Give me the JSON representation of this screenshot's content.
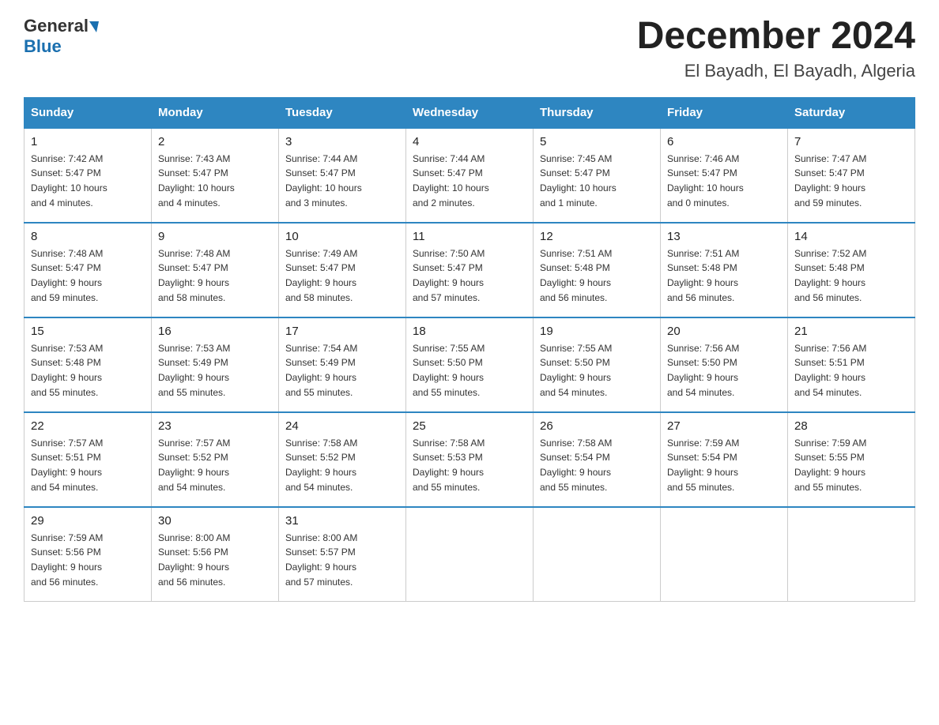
{
  "header": {
    "logo_general": "General",
    "logo_blue": "Blue",
    "month_title": "December 2024",
    "location": "El Bayadh, El Bayadh, Algeria"
  },
  "calendar": {
    "days_of_week": [
      "Sunday",
      "Monday",
      "Tuesday",
      "Wednesday",
      "Thursday",
      "Friday",
      "Saturday"
    ],
    "weeks": [
      [
        {
          "day": "1",
          "sunrise": "7:42 AM",
          "sunset": "5:47 PM",
          "daylight": "10 hours and 4 minutes."
        },
        {
          "day": "2",
          "sunrise": "7:43 AM",
          "sunset": "5:47 PM",
          "daylight": "10 hours and 4 minutes."
        },
        {
          "day": "3",
          "sunrise": "7:44 AM",
          "sunset": "5:47 PM",
          "daylight": "10 hours and 3 minutes."
        },
        {
          "day": "4",
          "sunrise": "7:44 AM",
          "sunset": "5:47 PM",
          "daylight": "10 hours and 2 minutes."
        },
        {
          "day": "5",
          "sunrise": "7:45 AM",
          "sunset": "5:47 PM",
          "daylight": "10 hours and 1 minute."
        },
        {
          "day": "6",
          "sunrise": "7:46 AM",
          "sunset": "5:47 PM",
          "daylight": "10 hours and 0 minutes."
        },
        {
          "day": "7",
          "sunrise": "7:47 AM",
          "sunset": "5:47 PM",
          "daylight": "9 hours and 59 minutes."
        }
      ],
      [
        {
          "day": "8",
          "sunrise": "7:48 AM",
          "sunset": "5:47 PM",
          "daylight": "9 hours and 59 minutes."
        },
        {
          "day": "9",
          "sunrise": "7:48 AM",
          "sunset": "5:47 PM",
          "daylight": "9 hours and 58 minutes."
        },
        {
          "day": "10",
          "sunrise": "7:49 AM",
          "sunset": "5:47 PM",
          "daylight": "9 hours and 58 minutes."
        },
        {
          "day": "11",
          "sunrise": "7:50 AM",
          "sunset": "5:47 PM",
          "daylight": "9 hours and 57 minutes."
        },
        {
          "day": "12",
          "sunrise": "7:51 AM",
          "sunset": "5:48 PM",
          "daylight": "9 hours and 56 minutes."
        },
        {
          "day": "13",
          "sunrise": "7:51 AM",
          "sunset": "5:48 PM",
          "daylight": "9 hours and 56 minutes."
        },
        {
          "day": "14",
          "sunrise": "7:52 AM",
          "sunset": "5:48 PM",
          "daylight": "9 hours and 56 minutes."
        }
      ],
      [
        {
          "day": "15",
          "sunrise": "7:53 AM",
          "sunset": "5:48 PM",
          "daylight": "9 hours and 55 minutes."
        },
        {
          "day": "16",
          "sunrise": "7:53 AM",
          "sunset": "5:49 PM",
          "daylight": "9 hours and 55 minutes."
        },
        {
          "day": "17",
          "sunrise": "7:54 AM",
          "sunset": "5:49 PM",
          "daylight": "9 hours and 55 minutes."
        },
        {
          "day": "18",
          "sunrise": "7:55 AM",
          "sunset": "5:50 PM",
          "daylight": "9 hours and 55 minutes."
        },
        {
          "day": "19",
          "sunrise": "7:55 AM",
          "sunset": "5:50 PM",
          "daylight": "9 hours and 54 minutes."
        },
        {
          "day": "20",
          "sunrise": "7:56 AM",
          "sunset": "5:50 PM",
          "daylight": "9 hours and 54 minutes."
        },
        {
          "day": "21",
          "sunrise": "7:56 AM",
          "sunset": "5:51 PM",
          "daylight": "9 hours and 54 minutes."
        }
      ],
      [
        {
          "day": "22",
          "sunrise": "7:57 AM",
          "sunset": "5:51 PM",
          "daylight": "9 hours and 54 minutes."
        },
        {
          "day": "23",
          "sunrise": "7:57 AM",
          "sunset": "5:52 PM",
          "daylight": "9 hours and 54 minutes."
        },
        {
          "day": "24",
          "sunrise": "7:58 AM",
          "sunset": "5:52 PM",
          "daylight": "9 hours and 54 minutes."
        },
        {
          "day": "25",
          "sunrise": "7:58 AM",
          "sunset": "5:53 PM",
          "daylight": "9 hours and 55 minutes."
        },
        {
          "day": "26",
          "sunrise": "7:58 AM",
          "sunset": "5:54 PM",
          "daylight": "9 hours and 55 minutes."
        },
        {
          "day": "27",
          "sunrise": "7:59 AM",
          "sunset": "5:54 PM",
          "daylight": "9 hours and 55 minutes."
        },
        {
          "day": "28",
          "sunrise": "7:59 AM",
          "sunset": "5:55 PM",
          "daylight": "9 hours and 55 minutes."
        }
      ],
      [
        {
          "day": "29",
          "sunrise": "7:59 AM",
          "sunset": "5:56 PM",
          "daylight": "9 hours and 56 minutes."
        },
        {
          "day": "30",
          "sunrise": "8:00 AM",
          "sunset": "5:56 PM",
          "daylight": "9 hours and 56 minutes."
        },
        {
          "day": "31",
          "sunrise": "8:00 AM",
          "sunset": "5:57 PM",
          "daylight": "9 hours and 57 minutes."
        },
        null,
        null,
        null,
        null
      ]
    ]
  },
  "labels": {
    "sunrise": "Sunrise:",
    "sunset": "Sunset:",
    "daylight": "Daylight:"
  }
}
